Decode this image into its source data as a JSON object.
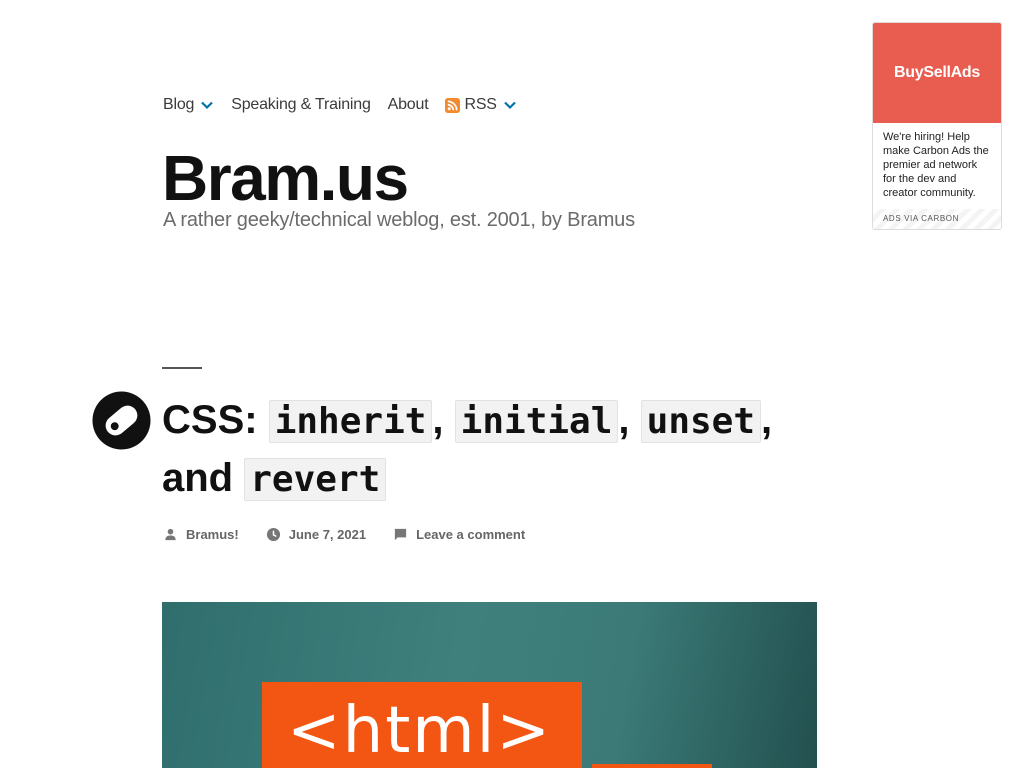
{
  "nav": {
    "items": [
      {
        "label": "Blog",
        "has_dropdown": true
      },
      {
        "label": "Speaking & Training",
        "has_dropdown": false
      },
      {
        "label": "About",
        "has_dropdown": false
      },
      {
        "label": "RSS",
        "has_dropdown": true,
        "icon": "rss-icon"
      }
    ]
  },
  "site": {
    "title": "Bram.us",
    "description": "A rather geeky/technical weblog, est. 2001, by Bramus"
  },
  "ad": {
    "brand": "BuySellAds",
    "text": "We're hiring! Help make Carbon Ads the premier ad network for the dev and creator community.",
    "via": "ADS VIA CARBON",
    "brand_color": "#e95c50"
  },
  "post": {
    "title_prefix": "CSS:",
    "keyword1": "inherit",
    "sep1": ",",
    "keyword2": "initial",
    "sep2": ",",
    "keyword3": "unset",
    "sep3": ",",
    "and": "and",
    "keyword4": "revert",
    "author": "Bramus!",
    "date": "June 7, 2021",
    "comments": "Leave a comment",
    "featured_text": "<html>"
  },
  "colors": {
    "accent_blue": "#0073aa",
    "rss_orange": "#f38a2e"
  }
}
